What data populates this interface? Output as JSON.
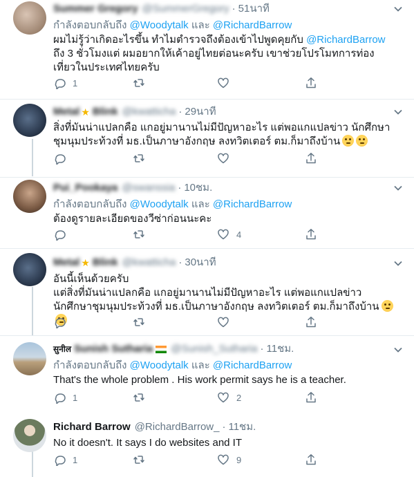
{
  "replying_label": "กำลังตอบกลับถึง",
  "and_label": "และ",
  "tweets": [
    {
      "name": "Summer Gregory",
      "handle": "@SummerGregory",
      "time": "51นาที",
      "mentions": [
        "@Woodytalk",
        "@RichardBarrow"
      ],
      "text_before": "ผมไม่รู้ว่าเกิดอะไรขึ้น ทำไมตำรวจถึงต้องเข้าไปพูดคุยกับ ",
      "text_mention": "@RichardBarrow",
      "text_after": " ถึง 3 ชั่วโมงแต่ ผมอยากให้เค้าอยู่ไทยต่อนะครับ เขาช่วยโปรโมทการท่องเที่ยวในประเทศไทยครับ",
      "replies": "1",
      "retweets": "",
      "likes": ""
    },
    {
      "name": "Metal",
      "name2": "Blink",
      "handle": "@kwatticha",
      "time": "29นาที",
      "text": "สิ่งที่มันน่าแปลกคือ แกอยู่มานานไม่มีปัญหาอะไร แต่พอแกแปลข่าว นักศึกษาชุมนุมประท้วงที่ มธ.เป็นภาษาอังกฤษ ลงทวิตเตอร์ ตม.ก็มาถึงบ้าน",
      "replies": "",
      "retweets": "",
      "likes": ""
    },
    {
      "name": "Pui_Pookaya",
      "handle": "@swanssia",
      "time": "10ชม.",
      "mentions": [
        "@Woodytalk",
        "@RichardBarrow"
      ],
      "text": "ต้องดูรายละเอียดของวีซ่าก่อนนะคะ",
      "replies": "",
      "retweets": "",
      "likes": "4"
    },
    {
      "name": "Metal",
      "name2": "Blink",
      "handle": "@kwatticha",
      "time": "30นาที",
      "text": "อันนี้เห็นด้วยครับ\nแต่สิ่งที่มันน่าแปลกคือ แกอยู่มานานไม่มีปัญหาอะไร แต่พอแกแปลข่าว นักศึกษาชุมนุมประท้วงที่ มธ.เป็นภาษาอังกฤษ ลงทวิตเตอร์ ตม.ก็มาถึงบ้าน",
      "replies": "",
      "retweets": "",
      "likes": ""
    },
    {
      "name_prefix": "सुनील",
      "name": "Sunish Sutharia",
      "handle": "@Sunish_Sutharia",
      "time": "11ชม.",
      "mentions": [
        "@Woodytalk",
        "@RichardBarrow"
      ],
      "text": "That's the whole problem . His work permit says he is a teacher.",
      "replies": "1",
      "retweets": "",
      "likes": "2"
    },
    {
      "name": "Richard Barrow",
      "handle": "@RichardBarrow_",
      "time": "11ชม.",
      "text": "No it doesn't. It says I do websites and IT",
      "replies": "1",
      "retweets": "",
      "likes": "9"
    }
  ],
  "colors": {
    "link": "#1da1f2",
    "secondary_text": "#657786",
    "divider": "#e6ecf0"
  },
  "icons": [
    "reply-icon",
    "retweet-icon",
    "like-icon",
    "share-icon",
    "chevron-down-icon"
  ]
}
